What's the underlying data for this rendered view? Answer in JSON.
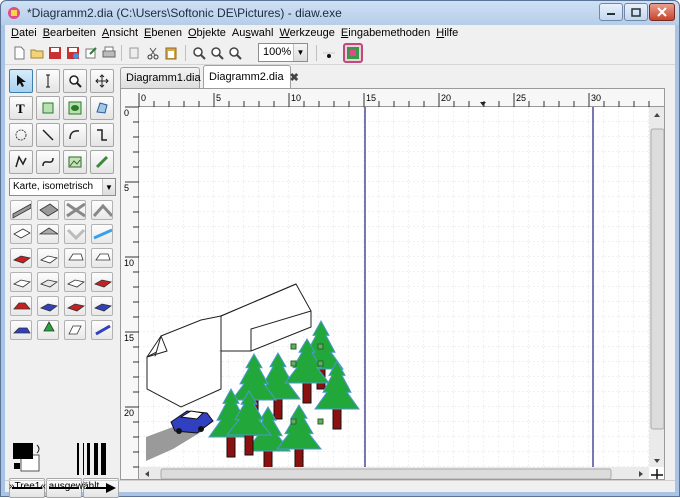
{
  "window": {
    "title": "*Diagramm2.dia (C:\\Users\\Softonic DE\\Pictures) - diaw.exe"
  },
  "menu": [
    {
      "pre": "",
      "u": "D",
      "post": "atei"
    },
    {
      "pre": "",
      "u": "B",
      "post": "earbeiten"
    },
    {
      "pre": "",
      "u": "A",
      "post": "nsicht"
    },
    {
      "pre": "",
      "u": "E",
      "post": "benen"
    },
    {
      "pre": "",
      "u": "O",
      "post": "bjekte"
    },
    {
      "pre": "Au",
      "u": "s",
      "post": "wahl"
    },
    {
      "pre": "",
      "u": "W",
      "post": "erkzeuge"
    },
    {
      "pre": "",
      "u": "E",
      "post": "ingabemethoden"
    },
    {
      "pre": "",
      "u": "H",
      "post": "ilfe"
    }
  ],
  "toolbar": {
    "zoom_value": "100%"
  },
  "toolbox": {
    "sheet_selected": "Karte, isometrisch"
  },
  "tabs": [
    {
      "label": "Diagramm1.dia",
      "active": false
    },
    {
      "label": "Diagramm2.dia",
      "active": true
    }
  ],
  "ruler": {
    "h_labels": [
      "0",
      "5",
      "10",
      "15",
      "20",
      "25",
      "30"
    ],
    "v_labels": [
      "0",
      "5",
      "10",
      "15",
      "20"
    ]
  },
  "status": {
    "text": "»Tree1« ausgewählt"
  },
  "colors": {
    "tree_green": "#22a83a",
    "trunk": "#8b1010",
    "car": "#3040c0",
    "page_break": "#4a4a9a"
  }
}
